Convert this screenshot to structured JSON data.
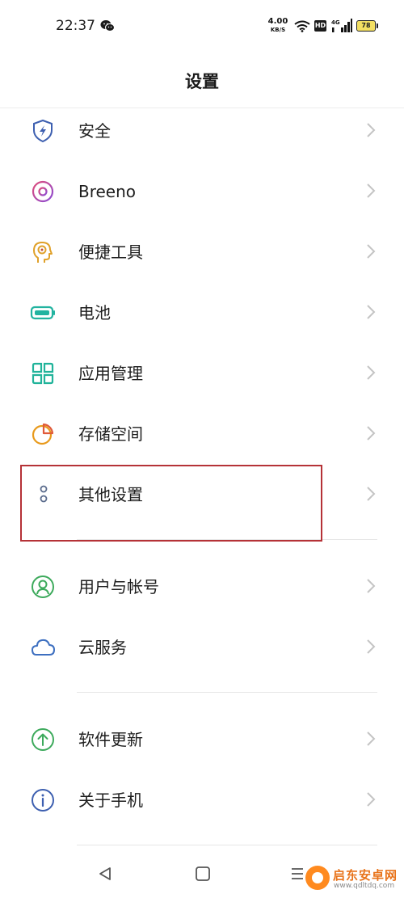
{
  "status": {
    "time": "22:37",
    "net_speed_value": "4.00",
    "net_speed_unit": "KB/S",
    "hd": "HD",
    "signal": "4G",
    "battery": "78"
  },
  "header": {
    "title": "设置"
  },
  "settings": [
    {
      "label": "安全",
      "icon": "shield-icon",
      "color": "#3d5fb0"
    },
    {
      "label": "Breeno",
      "icon": "breeno-icon",
      "color": "#c04dc9"
    },
    {
      "label": "便捷工具",
      "icon": "head-gear-icon",
      "color": "#e0a12a"
    },
    {
      "label": "电池",
      "icon": "battery-icon",
      "color": "#22b3a0"
    },
    {
      "label": "应用管理",
      "icon": "app-grid-icon",
      "color": "#20b39a"
    },
    {
      "label": "存储空间",
      "icon": "pie-chart-icon",
      "color": "#e89a1c"
    },
    {
      "label": "其他设置",
      "icon": "more-dots-icon",
      "color": "#5a6b8c"
    },
    {
      "label": "用户与帐号",
      "icon": "user-icon",
      "color": "#3daa5c"
    },
    {
      "label": "云服务",
      "icon": "cloud-icon",
      "color": "#3d6fc0"
    },
    {
      "label": "软件更新",
      "icon": "up-arrow-icon",
      "color": "#3daa5c"
    },
    {
      "label": "关于手机",
      "icon": "info-icon",
      "color": "#3d5fb0"
    }
  ],
  "watermark": {
    "name": "启东安卓网",
    "url": "www.qdltdq.com"
  }
}
